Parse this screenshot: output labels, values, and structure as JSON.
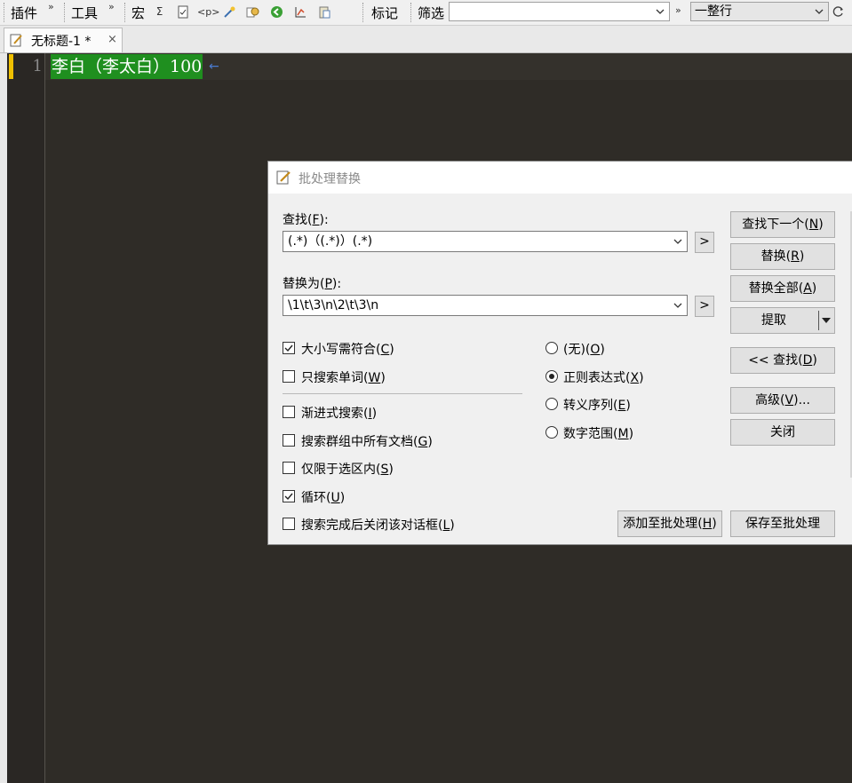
{
  "toolbar": {
    "plugins_label": "插件",
    "tools_label": "工具",
    "macro_label": "宏",
    "sigma": "Σ",
    "tag_icon_text": "<p>",
    "mark_label": "标记",
    "filter_label": "筛选",
    "filter_value": "",
    "overflow": "»",
    "line_mode_value": "一整行"
  },
  "tab": {
    "title": "无标题-1 *",
    "close": "×"
  },
  "editor": {
    "line_number": "1",
    "line_text": "李白（李太白）100",
    "eol_mark": "←"
  },
  "dialog": {
    "title": "批处理替换",
    "find_label": "查找(",
    "find_key": "F",
    "find_suffix": "):",
    "find_value": "(.*)（(.*)）(.*)",
    "replace_label": "替换为(",
    "replace_key": "P",
    "replace_suffix": "):",
    "replace_value": "\\1\\t\\3\\n\\2\\t\\3\\n",
    "expand_glyph": ">",
    "options": {
      "match_case": {
        "label": "大小写需符合(",
        "key": "C",
        "suffix": ")",
        "checked": true
      },
      "whole_word": {
        "label": "只搜索单词(",
        "key": "W",
        "suffix": ")",
        "checked": false
      },
      "incremental": {
        "label": "渐进式搜索(",
        "key": "I",
        "suffix": ")",
        "checked": false
      },
      "all_docs": {
        "label": "搜索群组中所有文档(",
        "key": "G",
        "suffix": ")",
        "checked": false
      },
      "in_selection": {
        "label": "仅限于选区内(",
        "key": "S",
        "suffix": ")",
        "checked": false
      },
      "wrap": {
        "label": "循环(",
        "key": "U",
        "suffix": ")",
        "checked": true
      },
      "close_after": {
        "label": "搜索完成后关闭该对话框(",
        "key": "L",
        "suffix": ")",
        "checked": false
      }
    },
    "modes": {
      "none": {
        "label": "(无)(",
        "key": "O",
        "suffix": ")",
        "selected": false
      },
      "regex": {
        "label": "正则表达式(",
        "key": "X",
        "suffix": ")",
        "selected": true
      },
      "escape": {
        "label": "转义序列(",
        "key": "E",
        "suffix": ")",
        "selected": false
      },
      "numeric": {
        "label": "数字范围(",
        "key": "M",
        "suffix": ")",
        "selected": false
      }
    },
    "buttons": {
      "find_next": {
        "label": "查找下一个(",
        "key": "N",
        "suffix": ")"
      },
      "replace": {
        "label": "替换(",
        "key": "R",
        "suffix": ")"
      },
      "replace_all": {
        "label": "替换全部(",
        "key": "A",
        "suffix": ")"
      },
      "extract": {
        "label": "提取"
      },
      "find_less": {
        "label": "<< 查找(",
        "key": "D",
        "suffix": ")"
      },
      "advanced": {
        "label": "高级(",
        "key": "V",
        "suffix": ")..."
      },
      "close": {
        "label": "关闭"
      },
      "add_batch": {
        "label": "添加至批处理(",
        "key": "H",
        "suffix": ")"
      },
      "save_batch": {
        "label": "保存至批处理"
      }
    }
  },
  "colors": {
    "editor_bg": "#2f2c27",
    "highlight": "#1f8f1f",
    "modified_mark": "#f0c000"
  }
}
